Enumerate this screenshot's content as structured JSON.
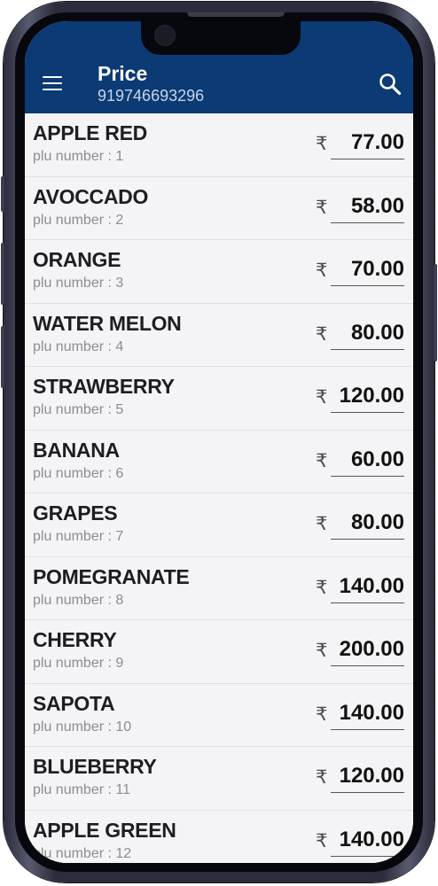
{
  "appbar": {
    "title": "Price",
    "subtitle": "919746693296",
    "menu_icon": "hamburger-menu-icon",
    "search_icon": "search-icon",
    "background": "#0b3a74"
  },
  "currency_symbol": "₹",
  "items": [
    {
      "name": "APPLE RED",
      "plu": "plu number : 1",
      "price": "77.00"
    },
    {
      "name": "AVOCCADO",
      "plu": "plu number : 2",
      "price": "58.00"
    },
    {
      "name": "ORANGE",
      "plu": "plu number : 3",
      "price": "70.00"
    },
    {
      "name": "WATER MELON",
      "plu": "plu number : 4",
      "price": "80.00"
    },
    {
      "name": "STRAWBERRY",
      "plu": "plu number : 5",
      "price": "120.00"
    },
    {
      "name": "BANANA",
      "plu": "plu number : 6",
      "price": "60.00"
    },
    {
      "name": "GRAPES",
      "plu": "plu number : 7",
      "price": "80.00"
    },
    {
      "name": "POMEGRANATE",
      "plu": "plu number : 8",
      "price": "140.00"
    },
    {
      "name": "CHERRY",
      "plu": "plu number : 9",
      "price": "200.00"
    },
    {
      "name": "SAPOTA",
      "plu": "plu number : 10",
      "price": "140.00"
    },
    {
      "name": "BLUEBERRY",
      "plu": "plu number : 11",
      "price": "120.00"
    },
    {
      "name": "APPLE GREEN",
      "plu": "plu number : 12",
      "price": "140.00"
    }
  ]
}
